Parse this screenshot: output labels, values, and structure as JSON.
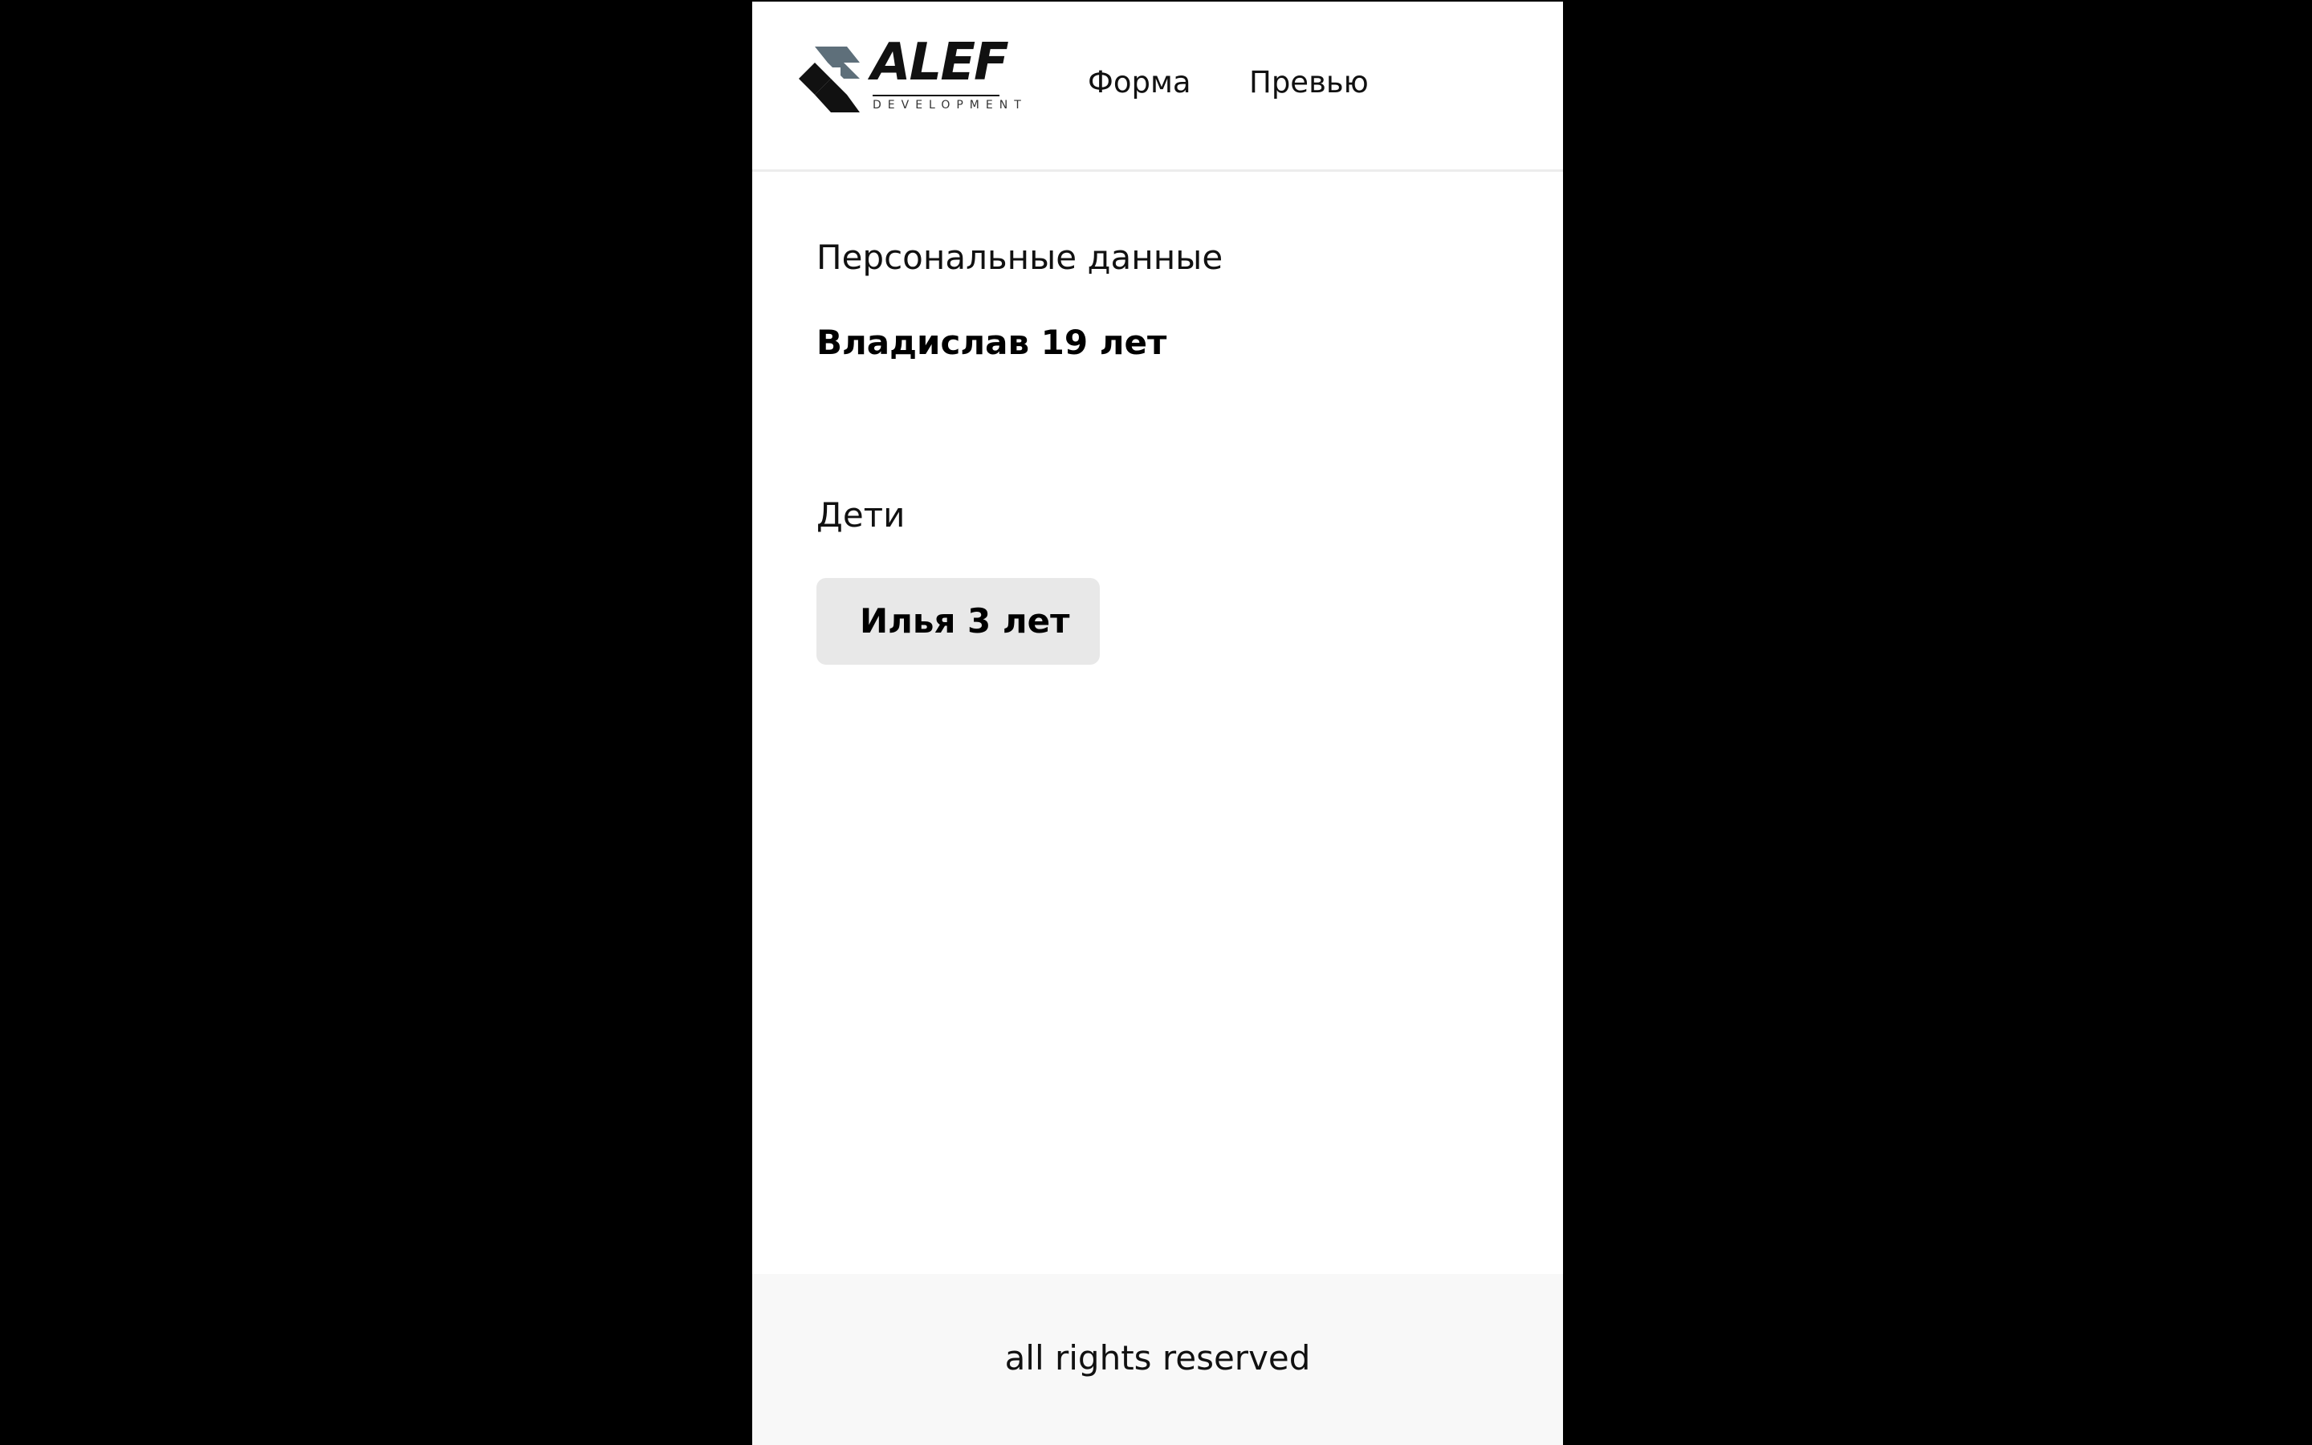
{
  "header": {
    "logo": {
      "wordmark": "ALEF",
      "subtitle": "DEVELOPMENT"
    },
    "nav": [
      {
        "label": "Форма"
      },
      {
        "label": "Превью"
      }
    ]
  },
  "main": {
    "personal": {
      "heading": "Персональные данные",
      "value": "Владислав 19 лет"
    },
    "children": {
      "heading": "Дети",
      "items": [
        {
          "label": "Илья 3 лет"
        }
      ]
    }
  },
  "footer": {
    "text": "all rights reserved"
  },
  "colors": {
    "page_background": "#ffffff",
    "outer_background": "#000000",
    "card_background": "#e8e8e8",
    "footer_background": "#f8f8f8",
    "logo_gray": "#5e6f7a",
    "text": "#111111"
  }
}
